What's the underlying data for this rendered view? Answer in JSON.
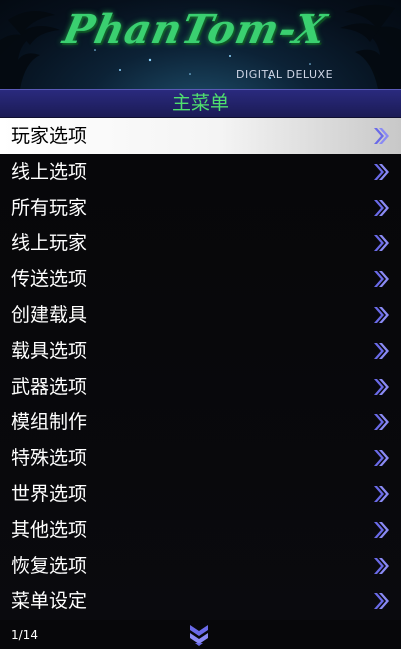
{
  "banner": {
    "logo_text": "PhanTom-X",
    "subtitle": "DIGITAL DELUXE"
  },
  "title": "主菜单",
  "items": [
    {
      "label": "玩家选项",
      "selected": true
    },
    {
      "label": "线上选项"
    },
    {
      "label": "所有玩家"
    },
    {
      "label": "线上玩家"
    },
    {
      "label": "传送选项"
    },
    {
      "label": "创建载具"
    },
    {
      "label": "载具选项"
    },
    {
      "label": "武器选项"
    },
    {
      "label": "模组制作"
    },
    {
      "label": "特殊选项"
    },
    {
      "label": "世界选项"
    },
    {
      "label": "其他选项"
    },
    {
      "label": "恢复选项"
    },
    {
      "label": "菜单设定"
    }
  ],
  "footer": {
    "counter": "1/14",
    "scroll_icon": "chevron-down-icon"
  },
  "colors": {
    "accent": "#4fe06e",
    "title_bar": "#24246c",
    "chevron": "#6a6ae8",
    "selected_bg": "#f4f4f4"
  }
}
